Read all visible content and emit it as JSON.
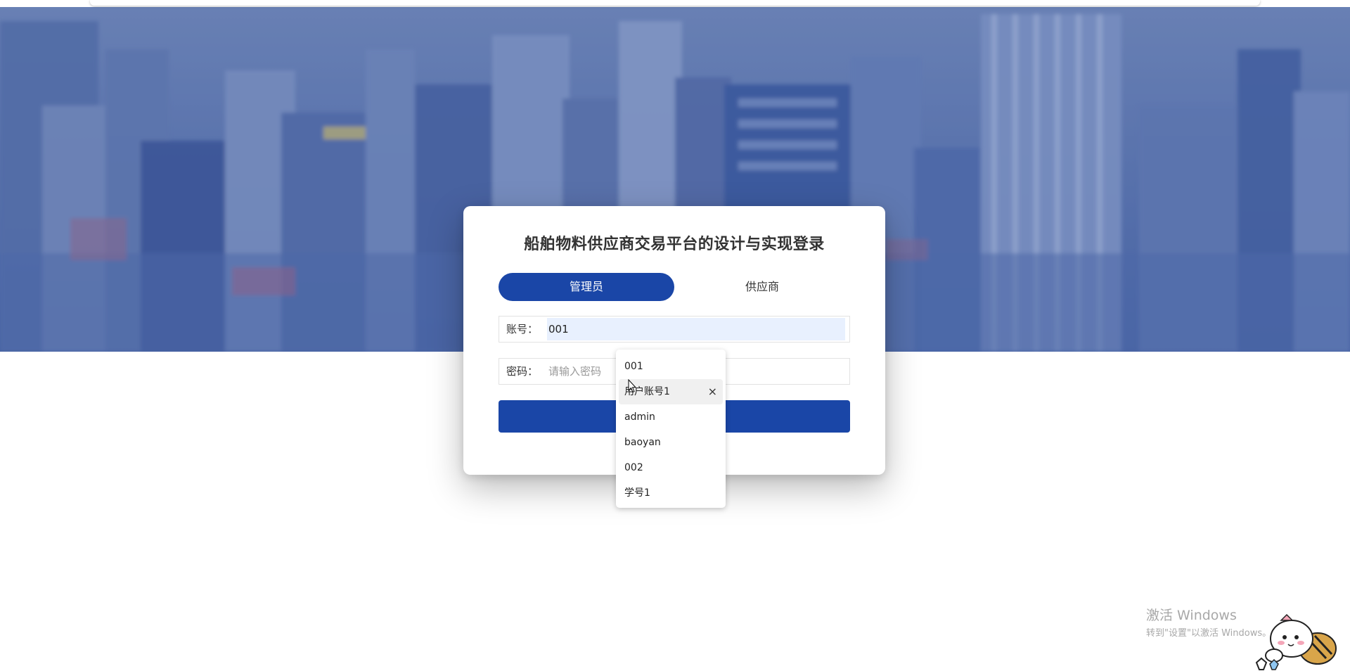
{
  "page": {
    "title": "船舶物料供应商交易平台的设计与实现登录"
  },
  "tabs": [
    {
      "label": "管理员",
      "active": true
    },
    {
      "label": "供应商",
      "active": false
    }
  ],
  "form": {
    "account_label": "账号：",
    "account_value": "001",
    "password_label": "密码：",
    "password_placeholder": "请输入密码",
    "submit_label": ""
  },
  "autocomplete": {
    "items": [
      {
        "label": "001"
      },
      {
        "label": "用户账号1",
        "hover": true,
        "remove_icon": "×"
      },
      {
        "label": "admin"
      },
      {
        "label": "baoyan"
      },
      {
        "label": "002"
      },
      {
        "label": "学号1"
      }
    ]
  },
  "watermark": {
    "title": "激活 Windows",
    "subtitle": "转到\"设置\"以激活 Windows。"
  },
  "colors": {
    "primary": "#1a46a7",
    "hero_blue": "#4f6aa6",
    "autofill_bg": "#e8f0fe"
  },
  "icons": {
    "cursor": "arrow-cursor-icon",
    "remove": "close-icon",
    "mascot": "mascot-sticker-icon"
  }
}
